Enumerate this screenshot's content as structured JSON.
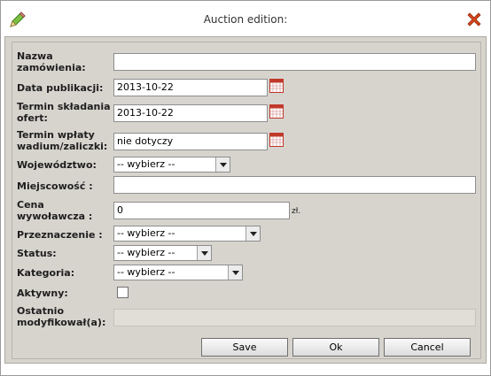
{
  "window": {
    "title": "Auction edition:"
  },
  "colors": {
    "panel": "#d7d4ce",
    "close_icon": "#d9461c",
    "calendar_icon": "#c0392b"
  },
  "fields": {
    "name": {
      "label": "Nazwa zamówienia:",
      "value": ""
    },
    "publication_date": {
      "label": "Data publikacji:",
      "value": "2013-10-22"
    },
    "offer_deadline": {
      "label": "Termin składania ofert:",
      "value": "2013-10-22"
    },
    "deposit_deadline": {
      "label": "Termin wpłaty wadium/zaliczki:",
      "value": "nie dotyczy"
    },
    "voivodeship": {
      "label": "Województwo:",
      "selected": "-- wybierz --"
    },
    "city": {
      "label": "Miejscowość :",
      "value": ""
    },
    "starting_price": {
      "label": "Cena wywoławcza :",
      "value": "0",
      "unit": "zł."
    },
    "purpose": {
      "label": "Przeznaczenie :",
      "selected": "-- wybierz --"
    },
    "status": {
      "label": "Status:",
      "selected": "-- wybierz --"
    },
    "category": {
      "label": "Kategoria:",
      "selected": "-- wybierz --"
    },
    "active": {
      "label": "Aktywny:",
      "checked": false
    },
    "last_modified_by": {
      "label": "Ostatnio modyfikował(a):",
      "value": ""
    }
  },
  "buttons": {
    "save": "Save",
    "ok": "Ok",
    "cancel": "Cancel"
  },
  "icons": {
    "edit": "pencil-icon",
    "close": "close-icon",
    "calendar": "calendar-icon",
    "dropdown": "chevron-down-icon"
  }
}
